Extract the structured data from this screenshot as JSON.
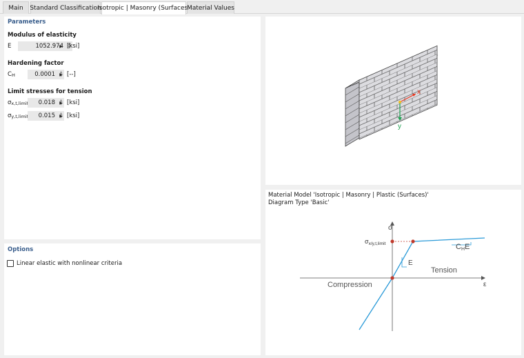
{
  "tabs": [
    {
      "label": "Main"
    },
    {
      "label": "Standard Classification"
    },
    {
      "label": "Isotropic | Masonry (Surfaces)"
    },
    {
      "label": "Material Values"
    }
  ],
  "parameters": {
    "title": "Parameters",
    "modulus": {
      "group_label": "Modulus of elasticity",
      "symbol": "E",
      "value": "1052.974",
      "unit": "[ksi]"
    },
    "hardening": {
      "group_label": "Hardening factor",
      "symbol_main": "C",
      "symbol_sub": "H",
      "value": "0.0001",
      "unit": "[--]"
    },
    "limit_stresses": {
      "group_label": "Limit stresses for tension",
      "rows": [
        {
          "symbol_main": "σ",
          "symbol_sub": "x,t,limit",
          "value": "0.018",
          "unit": "[ksi]"
        },
        {
          "symbol_main": "σ",
          "symbol_sub": "y,t,limit",
          "value": "0.015",
          "unit": "[ksi]"
        }
      ]
    }
  },
  "options": {
    "title": "Options",
    "linear_elastic_label": "Linear elastic with nonlinear criteria",
    "linear_elastic_checked": false
  },
  "wall_view": {
    "axis_x": "x",
    "axis_y": "y",
    "colors": {
      "x_axis": "#e8361e",
      "y_axis": "#1ea050",
      "origin": "#f0c020"
    }
  },
  "diagram": {
    "line1": "Material Model 'Isotropic | Masonry | Plastic (Surfaces)'",
    "line2": "Diagram Type 'Basic'",
    "label_sigma": "σ",
    "label_epsilon": "ε",
    "label_sigma_limit_main": "σ",
    "label_sigma_limit_sub": "x/y,t,limit",
    "label_E": "E",
    "label_CHE_main": "C",
    "label_CHE_sub": "H",
    "label_CHE_tail": "E",
    "label_tension": "Tension",
    "label_compression": "Compression",
    "colors": {
      "curve": "#2a9ad8",
      "points": "#c0392b",
      "axes": "#555555"
    }
  }
}
